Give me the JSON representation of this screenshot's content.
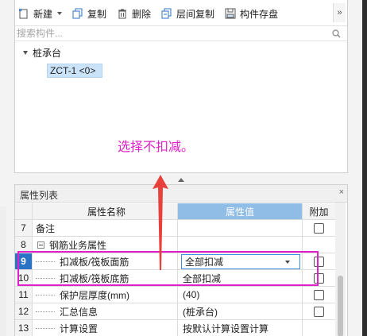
{
  "toolbar": {
    "new_label": "新建",
    "copy_label": "复制",
    "delete_label": "删除",
    "floor_copy_label": "层间复制",
    "store_label": "构件存盘",
    "more_label": "»"
  },
  "search": {
    "placeholder": "搜索构件..."
  },
  "tree": {
    "root_label": "桩承台",
    "child_label": "ZCT-1 <0>"
  },
  "annotation_text": "选择不扣减。",
  "properties": {
    "title": "属性列表",
    "close_label": "×",
    "headers": {
      "name": "属性名称",
      "value": "属性值",
      "add": "附加"
    },
    "rows": [
      {
        "num": "7",
        "name": "备注",
        "value": "",
        "checkbox": true
      },
      {
        "num": "8",
        "name": "钢筋业务属性",
        "value": "",
        "checkbox": false
      },
      {
        "num": "9",
        "name": "扣减板/筏板面筋",
        "value": "全部扣减",
        "checkbox": true
      },
      {
        "num": "10",
        "name": "扣减板/筏板底筋",
        "value": "全部扣减",
        "checkbox": true
      },
      {
        "num": "11",
        "name": "保护层厚度(mm)",
        "value": "(40)",
        "checkbox": true
      },
      {
        "num": "12",
        "name": "汇总信息",
        "value": "(桩承台)",
        "checkbox": true
      },
      {
        "num": "13",
        "name": "计算设置",
        "value": "按默认计算设置计算",
        "checkbox": false
      }
    ]
  },
  "colors": {
    "accent_header": "#8fbde6",
    "active_row_number": "#2b73c4",
    "annotation": "#e020c8",
    "arrow": "#e8403a"
  }
}
